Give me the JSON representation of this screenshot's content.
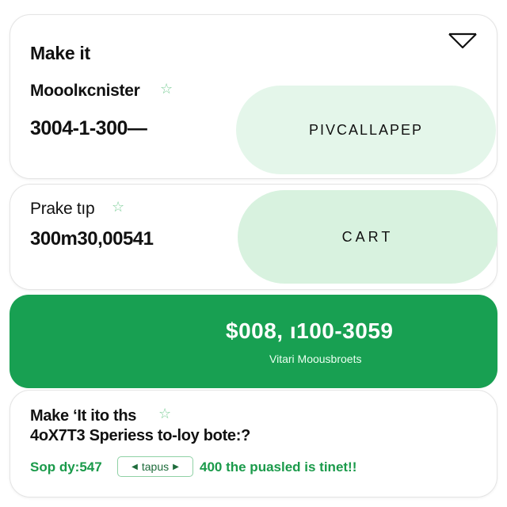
{
  "card1": {
    "title": "Make it",
    "subtitle": "Mooolĸcnister",
    "value": "3004-1-300—",
    "pill_label": "PIVCALLAPEP"
  },
  "card2": {
    "subtitle": "Prake tıp",
    "value": "300m30,00541",
    "pill_label": "CART"
  },
  "banner": {
    "amount": "$008, ı100-3059",
    "caption": "Vitari Moousbroets"
  },
  "card4": {
    "title": "Make ‘It ito ths",
    "subtitle": "4oX7T3 Speriess to-loy bote:?",
    "footer_left": "Sop dy:547",
    "chip_label": "tapus",
    "footer_right": "400 the puasled is tinet!!"
  },
  "icons": {
    "star": "star-outline-icon",
    "dropdown": "chevron-down-outline-icon",
    "chip_left": "arrow-left-icon",
    "chip_right": "arrow-right-icon"
  },
  "colors": {
    "accent_green": "#18a052",
    "pill_light_1": "#e4f6ea",
    "pill_light_2": "#d8f2df",
    "star": "#7fcf9a",
    "text_green": "#1a9a4a"
  }
}
